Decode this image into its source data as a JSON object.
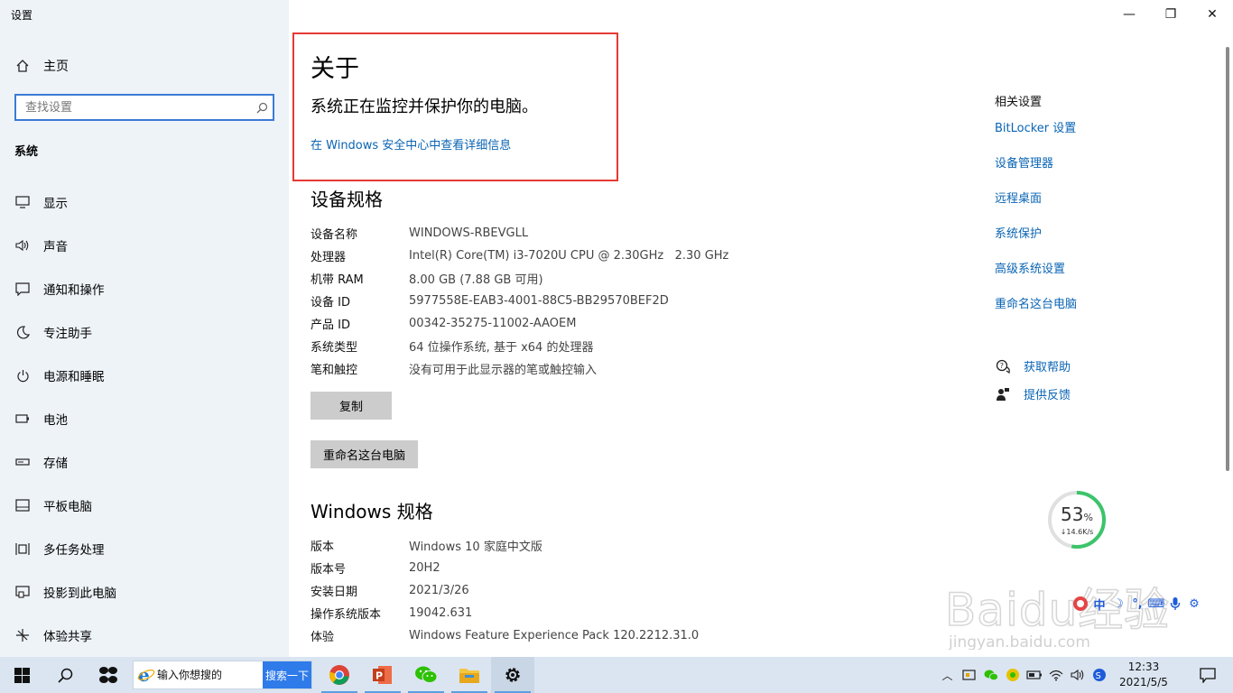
{
  "window": {
    "title": "设置",
    "minimize_glyph": "—",
    "maximize_glyph": "❐",
    "close_glyph": "✕"
  },
  "sidebar": {
    "home_label": "主页",
    "search_placeholder": "查找设置",
    "section_label": "系统",
    "items": [
      {
        "label": "显示",
        "icon": "monitor-icon"
      },
      {
        "label": "声音",
        "icon": "speaker-icon"
      },
      {
        "label": "通知和操作",
        "icon": "notification-icon"
      },
      {
        "label": "专注助手",
        "icon": "moon-icon"
      },
      {
        "label": "电源和睡眠",
        "icon": "power-icon"
      },
      {
        "label": "电池",
        "icon": "battery-icon"
      },
      {
        "label": "存储",
        "icon": "storage-icon"
      },
      {
        "label": "平板电脑",
        "icon": "tablet-icon"
      },
      {
        "label": "多任务处理",
        "icon": "multitask-icon"
      },
      {
        "label": "投影到此电脑",
        "icon": "project-icon"
      },
      {
        "label": "体验共享",
        "icon": "share-icon"
      }
    ]
  },
  "main": {
    "title": "关于",
    "protect_text": "系统正在监控并保护你的电脑。",
    "security_link": "在 Windows 安全中心中查看详细信息",
    "device_specs": {
      "heading": "设备规格",
      "rows": [
        {
          "key": "设备名称",
          "value": "WINDOWS-RBEVGLL"
        },
        {
          "key": "处理器",
          "value": "Intel(R) Core(TM) i3-7020U CPU @ 2.30GHz   2.30 GHz"
        },
        {
          "key": "机带 RAM",
          "value": "8.00 GB (7.88 GB 可用)"
        },
        {
          "key": "设备 ID",
          "value": "5977558E-EAB3-4001-88C5-BB29570BEF2D"
        },
        {
          "key": "产品 ID",
          "value": "00342-35275-11002-AAOEM"
        },
        {
          "key": "系统类型",
          "value": "64 位操作系统, 基于 x64 的处理器"
        },
        {
          "key": "笔和触控",
          "value": "没有可用于此显示器的笔或触控输入"
        }
      ],
      "copy_button": "复制",
      "rename_button": "重命名这台电脑"
    },
    "windows_specs": {
      "heading": "Windows 规格",
      "rows": [
        {
          "key": "版本",
          "value": "Windows 10 家庭中文版"
        },
        {
          "key": "版本号",
          "value": "20H2"
        },
        {
          "key": "安装日期",
          "value": "2021/3/26"
        },
        {
          "key": "操作系统版本",
          "value": "19042.631"
        },
        {
          "key": "体验",
          "value": "Windows Feature Experience Pack 120.2212.31.0"
        }
      ]
    }
  },
  "related": {
    "title": "相关设置",
    "links": [
      "BitLocker 设置",
      "设备管理器",
      "远程桌面",
      "系统保护",
      "高级系统设置",
      "重命名这台电脑"
    ],
    "help_label": "获取帮助",
    "feedback_label": "提供反馈"
  },
  "speed_widget": {
    "percent": "53",
    "percent_unit": "%",
    "rate": "↓14.6K/s",
    "fraction": 0.53
  },
  "ime_bar": {
    "chinese": "中",
    "half_moon": "☽",
    "punct": "°,",
    "keyboard": "⌨",
    "mic": "🎤",
    "gear": "⚙"
  },
  "watermark": {
    "brand": "Baidu经验",
    "url": "jingyan.baidu.com"
  },
  "taskbar": {
    "search_placeholder": "输入你想搜的",
    "search_button": "搜索一下",
    "clock_time": "12:33",
    "clock_date": "2021/5/5"
  },
  "colors": {
    "accent_link": "#0a64b4",
    "highlight_border": "#e53935",
    "search_border": "#3a7bd5",
    "taskbar_bg": "#dbe5f1",
    "search_btn": "#2f7bea"
  }
}
